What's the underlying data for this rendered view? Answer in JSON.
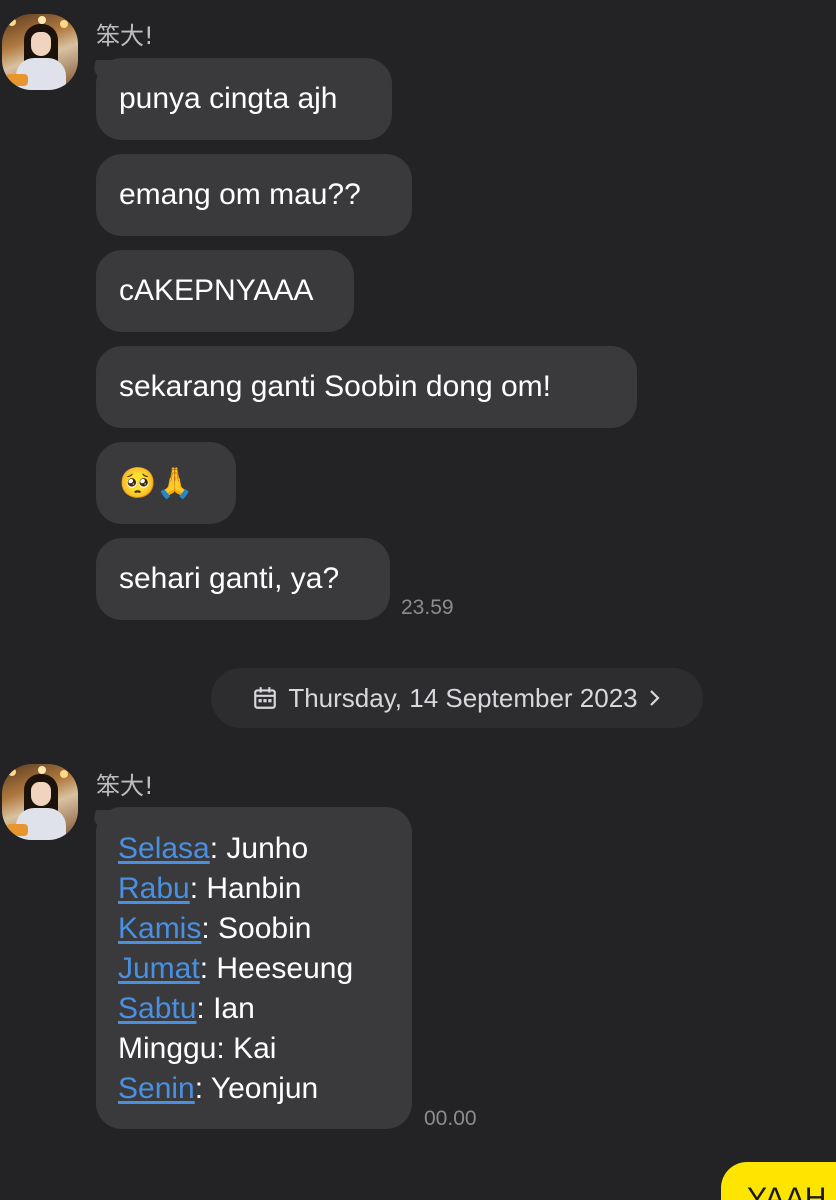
{
  "groups": [
    {
      "sender": "笨大!",
      "messages": [
        "punya cingta ajh",
        "emang om mau??",
        "cAKEPNYAAA",
        "sekarang ganti Soobin dong om!",
        "🥺🙏",
        "sehari ganti, ya?"
      ],
      "time": "23.59"
    }
  ],
  "date_divider": {
    "text": "Thursday, 14 September 2023",
    "icon": "calendar-icon",
    "chevron": "chevron-right-icon"
  },
  "second_group": {
    "sender": "笨大!",
    "schedule": [
      {
        "day": "Selasa",
        "rest": ": Junho",
        "link": true
      },
      {
        "day": "Rabu",
        "rest": ": Hanbin",
        "link": true
      },
      {
        "day": "Kamis",
        "rest": ": Soobin",
        "link": true
      },
      {
        "day": "Jumat",
        "rest": ": Heeseung",
        "link": true
      },
      {
        "day": "Sabtu",
        "rest": ": Ian",
        "link": true
      },
      {
        "day": "Minggu",
        "rest": ": Kai",
        "link": false
      },
      {
        "day": "Senin",
        "rest": ": Yeonjun",
        "link": true
      }
    ],
    "time": "00.00"
  },
  "outgoing_preview": "YAAH",
  "colors": {
    "background": "#232325",
    "incoming_bubble": "#3a3a3c",
    "outgoing_bubble": "#fee500",
    "link": "#4a90e2"
  }
}
